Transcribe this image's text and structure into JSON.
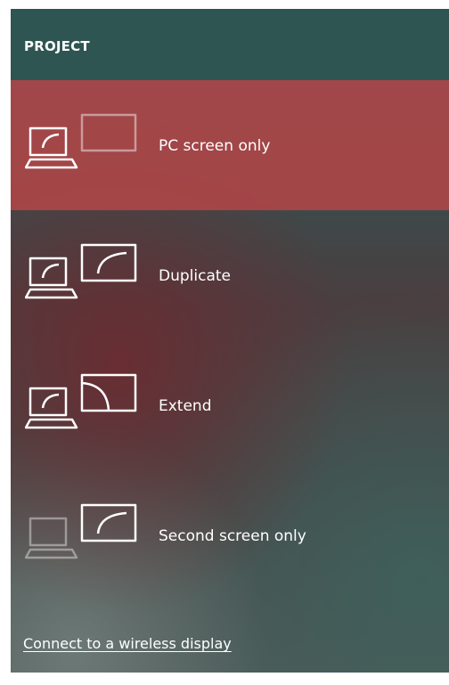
{
  "header": {
    "title": "PROJECT"
  },
  "options": [
    {
      "label": "PC screen only",
      "icon": "pc-screen-only-icon",
      "selected": true
    },
    {
      "label": "Duplicate",
      "icon": "duplicate-icon",
      "selected": false
    },
    {
      "label": "Extend",
      "icon": "extend-icon",
      "selected": false
    },
    {
      "label": "Second screen only",
      "icon": "second-screen-only-icon",
      "selected": false
    }
  ],
  "footer": {
    "wireless_link": "Connect to a wireless display"
  },
  "colors": {
    "header_bg": "#2e5552",
    "selected_bg": "#b04648",
    "text": "#ffffff"
  }
}
